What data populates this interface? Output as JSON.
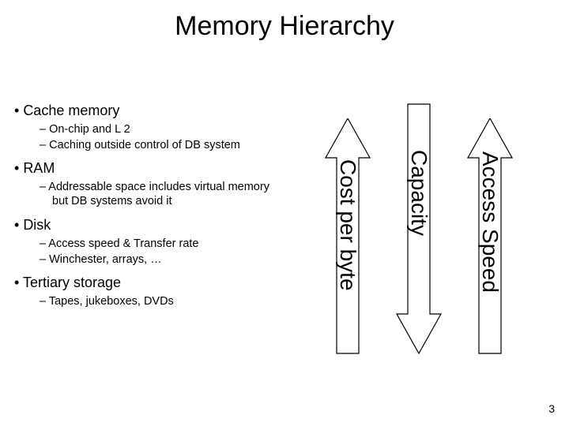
{
  "title": "Memory Hierarchy",
  "bullets": [
    {
      "label": "Cache memory",
      "subs": [
        "On-chip and L 2",
        "Caching outside control of DB system"
      ]
    },
    {
      "label": "RAM",
      "subs": [
        "Addressable space includes virtual memory but DB systems avoid it"
      ]
    },
    {
      "label": "Disk",
      "subs": [
        "Access speed & Transfer rate",
        "Winchester, arrays, …"
      ]
    },
    {
      "label": "Tertiary storage",
      "subs": [
        "Tapes, jukeboxes, DVDs"
      ]
    }
  ],
  "arrows": {
    "cost": "Cost per byte",
    "capacity": "Capacity",
    "speed": "Access Speed"
  },
  "page": "3"
}
